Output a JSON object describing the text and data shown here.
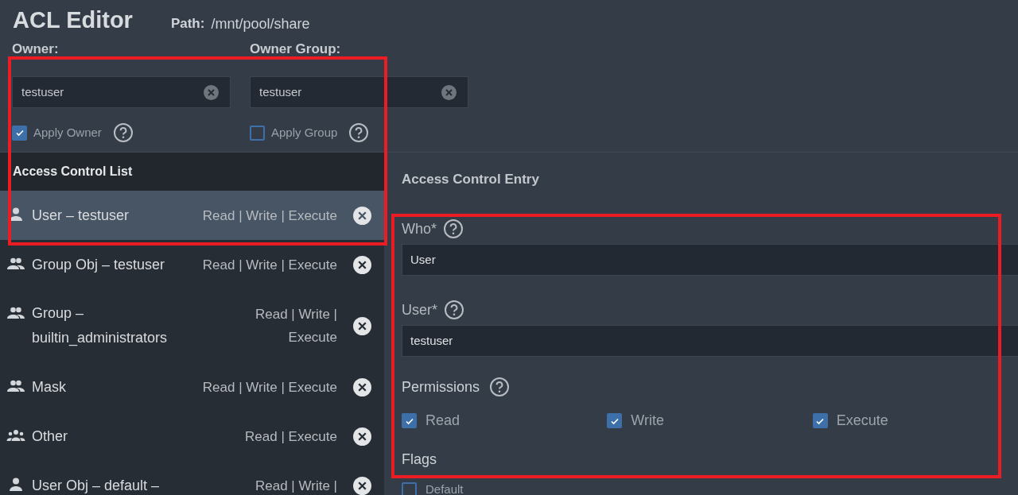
{
  "title": "ACL Editor",
  "path": {
    "label": "Path:",
    "value": "/mnt/pool/share"
  },
  "owners": [
    {
      "label": "Owner:",
      "value": "testuser",
      "apply": {
        "label": "Apply Owner",
        "checked": true
      }
    },
    {
      "label": "Owner Group:",
      "value": "testuser",
      "apply": {
        "label": "Apply Group",
        "checked": false
      }
    }
  ],
  "acl": {
    "title": "Access Control List",
    "items": [
      {
        "kind": "user",
        "name": "User – testuser",
        "permissions": "Read | Write | Execute",
        "selected": true
      },
      {
        "kind": "group",
        "name": "Group Obj – testuser",
        "permissions": "Read | Write | Execute",
        "selected": false
      },
      {
        "kind": "group",
        "name": "Group – builtin_administrators",
        "permissions": "Read | Write | Execute",
        "selected": false
      },
      {
        "kind": "group",
        "name": "Mask",
        "permissions": "Read | Write | Execute",
        "selected": false
      },
      {
        "kind": "everyone",
        "name": "Other",
        "permissions": "Read | Execute",
        "selected": false
      },
      {
        "kind": "user",
        "name": "User Obj – default –",
        "permissions": "Read | Write |",
        "selected": false
      }
    ]
  },
  "ace": {
    "title": "Access Control Entry",
    "fields": [
      {
        "label": "Who*",
        "value": "User"
      },
      {
        "label": "User*",
        "value": "testuser"
      }
    ],
    "permissions": {
      "label": "Permissions",
      "items": [
        {
          "label": "Read",
          "checked": true
        },
        {
          "label": "Write",
          "checked": true
        },
        {
          "label": "Execute",
          "checked": true
        }
      ]
    },
    "flags": {
      "label": "Flags",
      "items": [
        {
          "label": "Default",
          "checked": false
        }
      ]
    }
  },
  "highlights": [
    {
      "color": "#ec1c24"
    },
    {
      "color": "#ec1c24"
    }
  ]
}
